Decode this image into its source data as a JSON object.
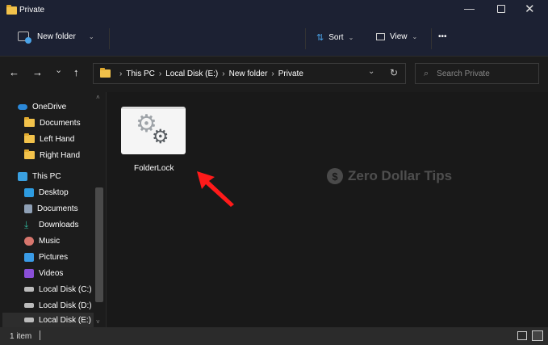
{
  "window": {
    "title": "Private",
    "minimize_icon": "minimize-icon",
    "maximize_icon": "maximize-icon",
    "close_icon": "close-icon"
  },
  "toolbar": {
    "new_folder": "New folder",
    "sort": "Sort",
    "view": "View",
    "more": "•••"
  },
  "address": {
    "crumbs": [
      "This PC",
      "Local Disk (E:)",
      "New folder",
      "Private"
    ],
    "search_placeholder": "Search Private"
  },
  "sidebar": {
    "onedrive": "OneDrive",
    "onedrive_items": [
      "Documents",
      "Left Hand",
      "Right Hand"
    ],
    "thispc": "This PC",
    "thispc_items": [
      "Desktop",
      "Documents",
      "Downloads",
      "Music",
      "Pictures",
      "Videos",
      "Local Disk (C:)",
      "Local Disk (D:)",
      "Local Disk (E:)"
    ]
  },
  "content": {
    "file_name": "FolderLock",
    "watermark": "Zero Dollar Tips",
    "watermark_symbol": "$"
  },
  "status": {
    "count": "1 item"
  },
  "colors": {
    "annotation_arrow": "#ff1a1a",
    "folder": "#f2c24b",
    "accent": "#4aa3e8"
  }
}
